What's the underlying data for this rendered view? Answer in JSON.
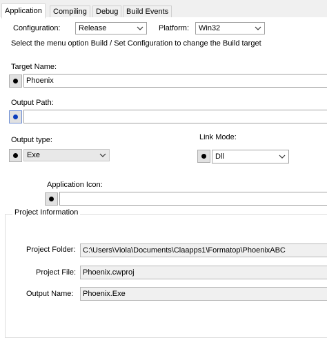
{
  "tabs": [
    {
      "label": "Application",
      "active": true
    },
    {
      "label": "Compiling",
      "active": false
    },
    {
      "label": "Debug",
      "active": false
    },
    {
      "label": "Build Events",
      "active": false
    }
  ],
  "configuration": {
    "label": "Configuration:",
    "value": "Release"
  },
  "platform": {
    "label": "Platform:",
    "value": "Win32"
  },
  "hint": "Select the menu option Build / Set Configuration to change the Build target",
  "target_name": {
    "label": "Target Name:",
    "value": "Phoenix"
  },
  "output_path": {
    "label": "Output Path:",
    "value": ""
  },
  "output_type": {
    "label": "Output type:",
    "value": "Exe"
  },
  "link_mode": {
    "label": "Link Mode:",
    "value": "Dll"
  },
  "app_icon": {
    "label": "Application Icon:",
    "value": ""
  },
  "project_info": {
    "title": "Project Information",
    "folder_label": "Project Folder:",
    "folder_value": "C:\\Users\\Viola\\Documents\\Claapps1\\Formatop\\PhoenixABC",
    "file_label": "Project File:",
    "file_value": "Phoenix.cwproj",
    "output_label": "Output Name:",
    "output_value": "Phoenix.Exe"
  },
  "colors": {
    "accent_dot": "#0a3dbd",
    "border": "#a0a0a0",
    "readonly_bg": "#f0f0f0"
  }
}
